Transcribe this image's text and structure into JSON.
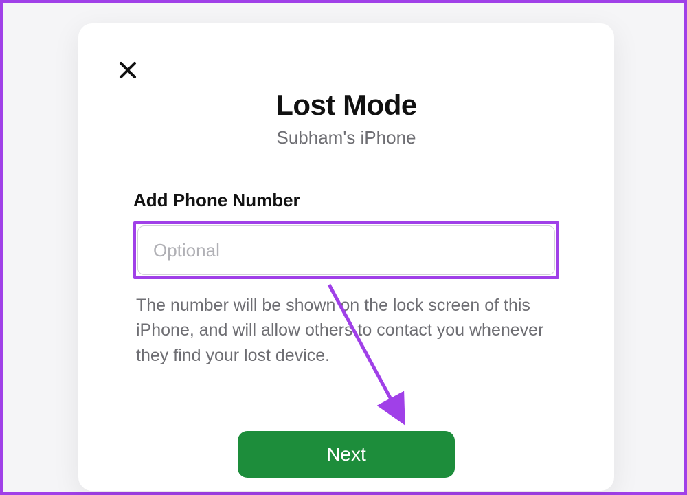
{
  "dialog": {
    "title": "Lost Mode",
    "subtitle": "Subham's iPhone",
    "phoneLabel": "Add Phone Number",
    "phonePlaceholder": "Optional",
    "phoneValue": "",
    "description": "The number will be shown on the lock screen of this iPhone, and will allow others to contact you whenever they find your lost device.",
    "nextLabel": "Next"
  },
  "annotations": {
    "highlightColor": "#a040e8",
    "arrowColor": "#a040e8"
  }
}
